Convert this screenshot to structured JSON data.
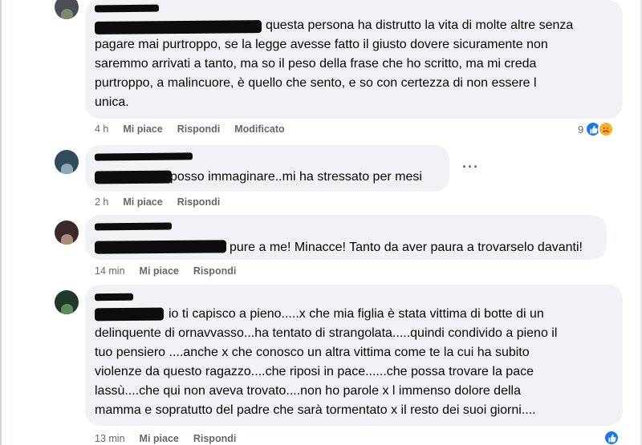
{
  "comments": [
    {
      "text": "questa persona ha distrutto la vita di molte altre senza\npagare mai purtroppo, se la legge avesse fatto il giusto dovere sicuramente non\nsaremmo arrivati a tanto, ma so il peso della frase che ho scritto, ma mi creda\npurtroppo, a malincuore, è quello che sento, e so con certezza di non essere l\nunica.",
      "time": "4 h",
      "like_label": "Mi piace",
      "reply_label": "Rispondi",
      "edited_label": "Modificato",
      "reaction_count": "9"
    },
    {
      "text": "posso immaginare..mi ha stressato per mesi",
      "time": "2 h",
      "like_label": "Mi piace",
      "reply_label": "Rispondi",
      "more_label": "···"
    },
    {
      "text": "pure a me! Minacce! Tanto da aver paura a trovarselo davanti!",
      "time": "14 min",
      "like_label": "Mi piace",
      "reply_label": "Rispondi"
    },
    {
      "text": "io ti capisco a pieno.....x che mia figlia è stata vittima di botte di un\ndelinquente di ornavvasso...ha tentato di strangolata.....quindi condivido a pieno il\ntuo pensiero ....anche x che conosco un altra vittima come te la cui ha subito\nviolenze da questo ragazzo....che riposi in pace......che possa trovare la pace\nlassù....che qui non aveva trovato....non ho parole x l immenso dolore della\nmamma e sopratutto del padre che sarà tormentato x il resto dei suoi giorni....",
      "time": "13 min",
      "like_label": "Mi piace",
      "reply_label": "Rispondi"
    }
  ],
  "colors": {
    "bubble": "#f0f2f5",
    "meta": "#65676b",
    "like_blue": "#1877f2",
    "care_yellow": "#f7b125"
  },
  "icons": {
    "like": "thumbs-up-icon",
    "care": "care-emoji-icon",
    "more": "more-options-icon"
  }
}
